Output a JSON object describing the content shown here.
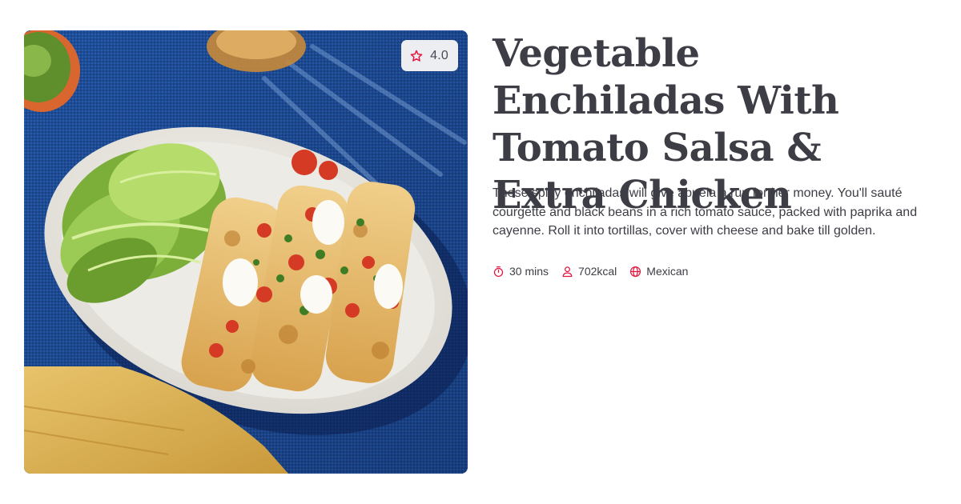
{
  "recipe": {
    "title": "Vegetable Enchiladas With Tomato Salsa & Extra Chicken",
    "description": "These spicy enchiladas will give abuela a run for her money. You'll sauté courgette and black beans in a rich tomato sauce, packed with paprika and cayenne. Roll it into tortillas, cover with cheese and bake till golden.",
    "rating": "4.0",
    "meta": {
      "time": "30 mins",
      "calories": "702kcal",
      "cuisine": "Mexican"
    }
  },
  "icons": {
    "rating": "star-outline-icon",
    "time": "stopwatch-icon",
    "calories": "person-icon",
    "cuisine": "globe-icon"
  },
  "colors": {
    "accent": "#e4173e",
    "text": "#3d3d46",
    "badge_bg": "#eceef2",
    "tablecloth": "#1f4f9a"
  }
}
